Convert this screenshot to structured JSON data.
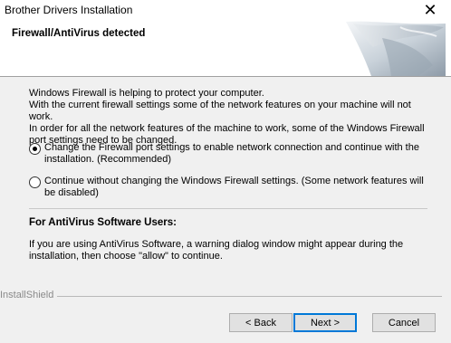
{
  "window": {
    "title": "Brother Drivers Installation",
    "close_glyph": "✕",
    "close_icon": "close-icon"
  },
  "header": {
    "heading": "Firewall/AntiVirus detected"
  },
  "intro": {
    "text": "Windows Firewall is helping to protect your computer.\nWith the current firewall settings some of the network features on your machine will not work.\nIn order for all the network features of the machine to work, some of the Windows Firewall port settings need to be changed."
  },
  "options": [
    {
      "label": "Change the Firewall port settings to enable network connection and continue with the installation. (Recommended)",
      "selected": true
    },
    {
      "label": "Continue without changing the Windows Firewall settings. (Some network features will be disabled)",
      "selected": false
    }
  ],
  "antivirus": {
    "heading": "For AntiVirus Software Users:",
    "text": "If you are using AntiVirus Software, a warning dialog window might appear during the installation, then choose \"allow\" to continue."
  },
  "footer": {
    "brand": "InstallShield",
    "back_label": "< Back",
    "next_label": "Next >",
    "cancel_label": "Cancel"
  },
  "colors": {
    "background": "#f0f0f0",
    "header_background": "#ffffff",
    "default_button_border": "#0078d7"
  }
}
